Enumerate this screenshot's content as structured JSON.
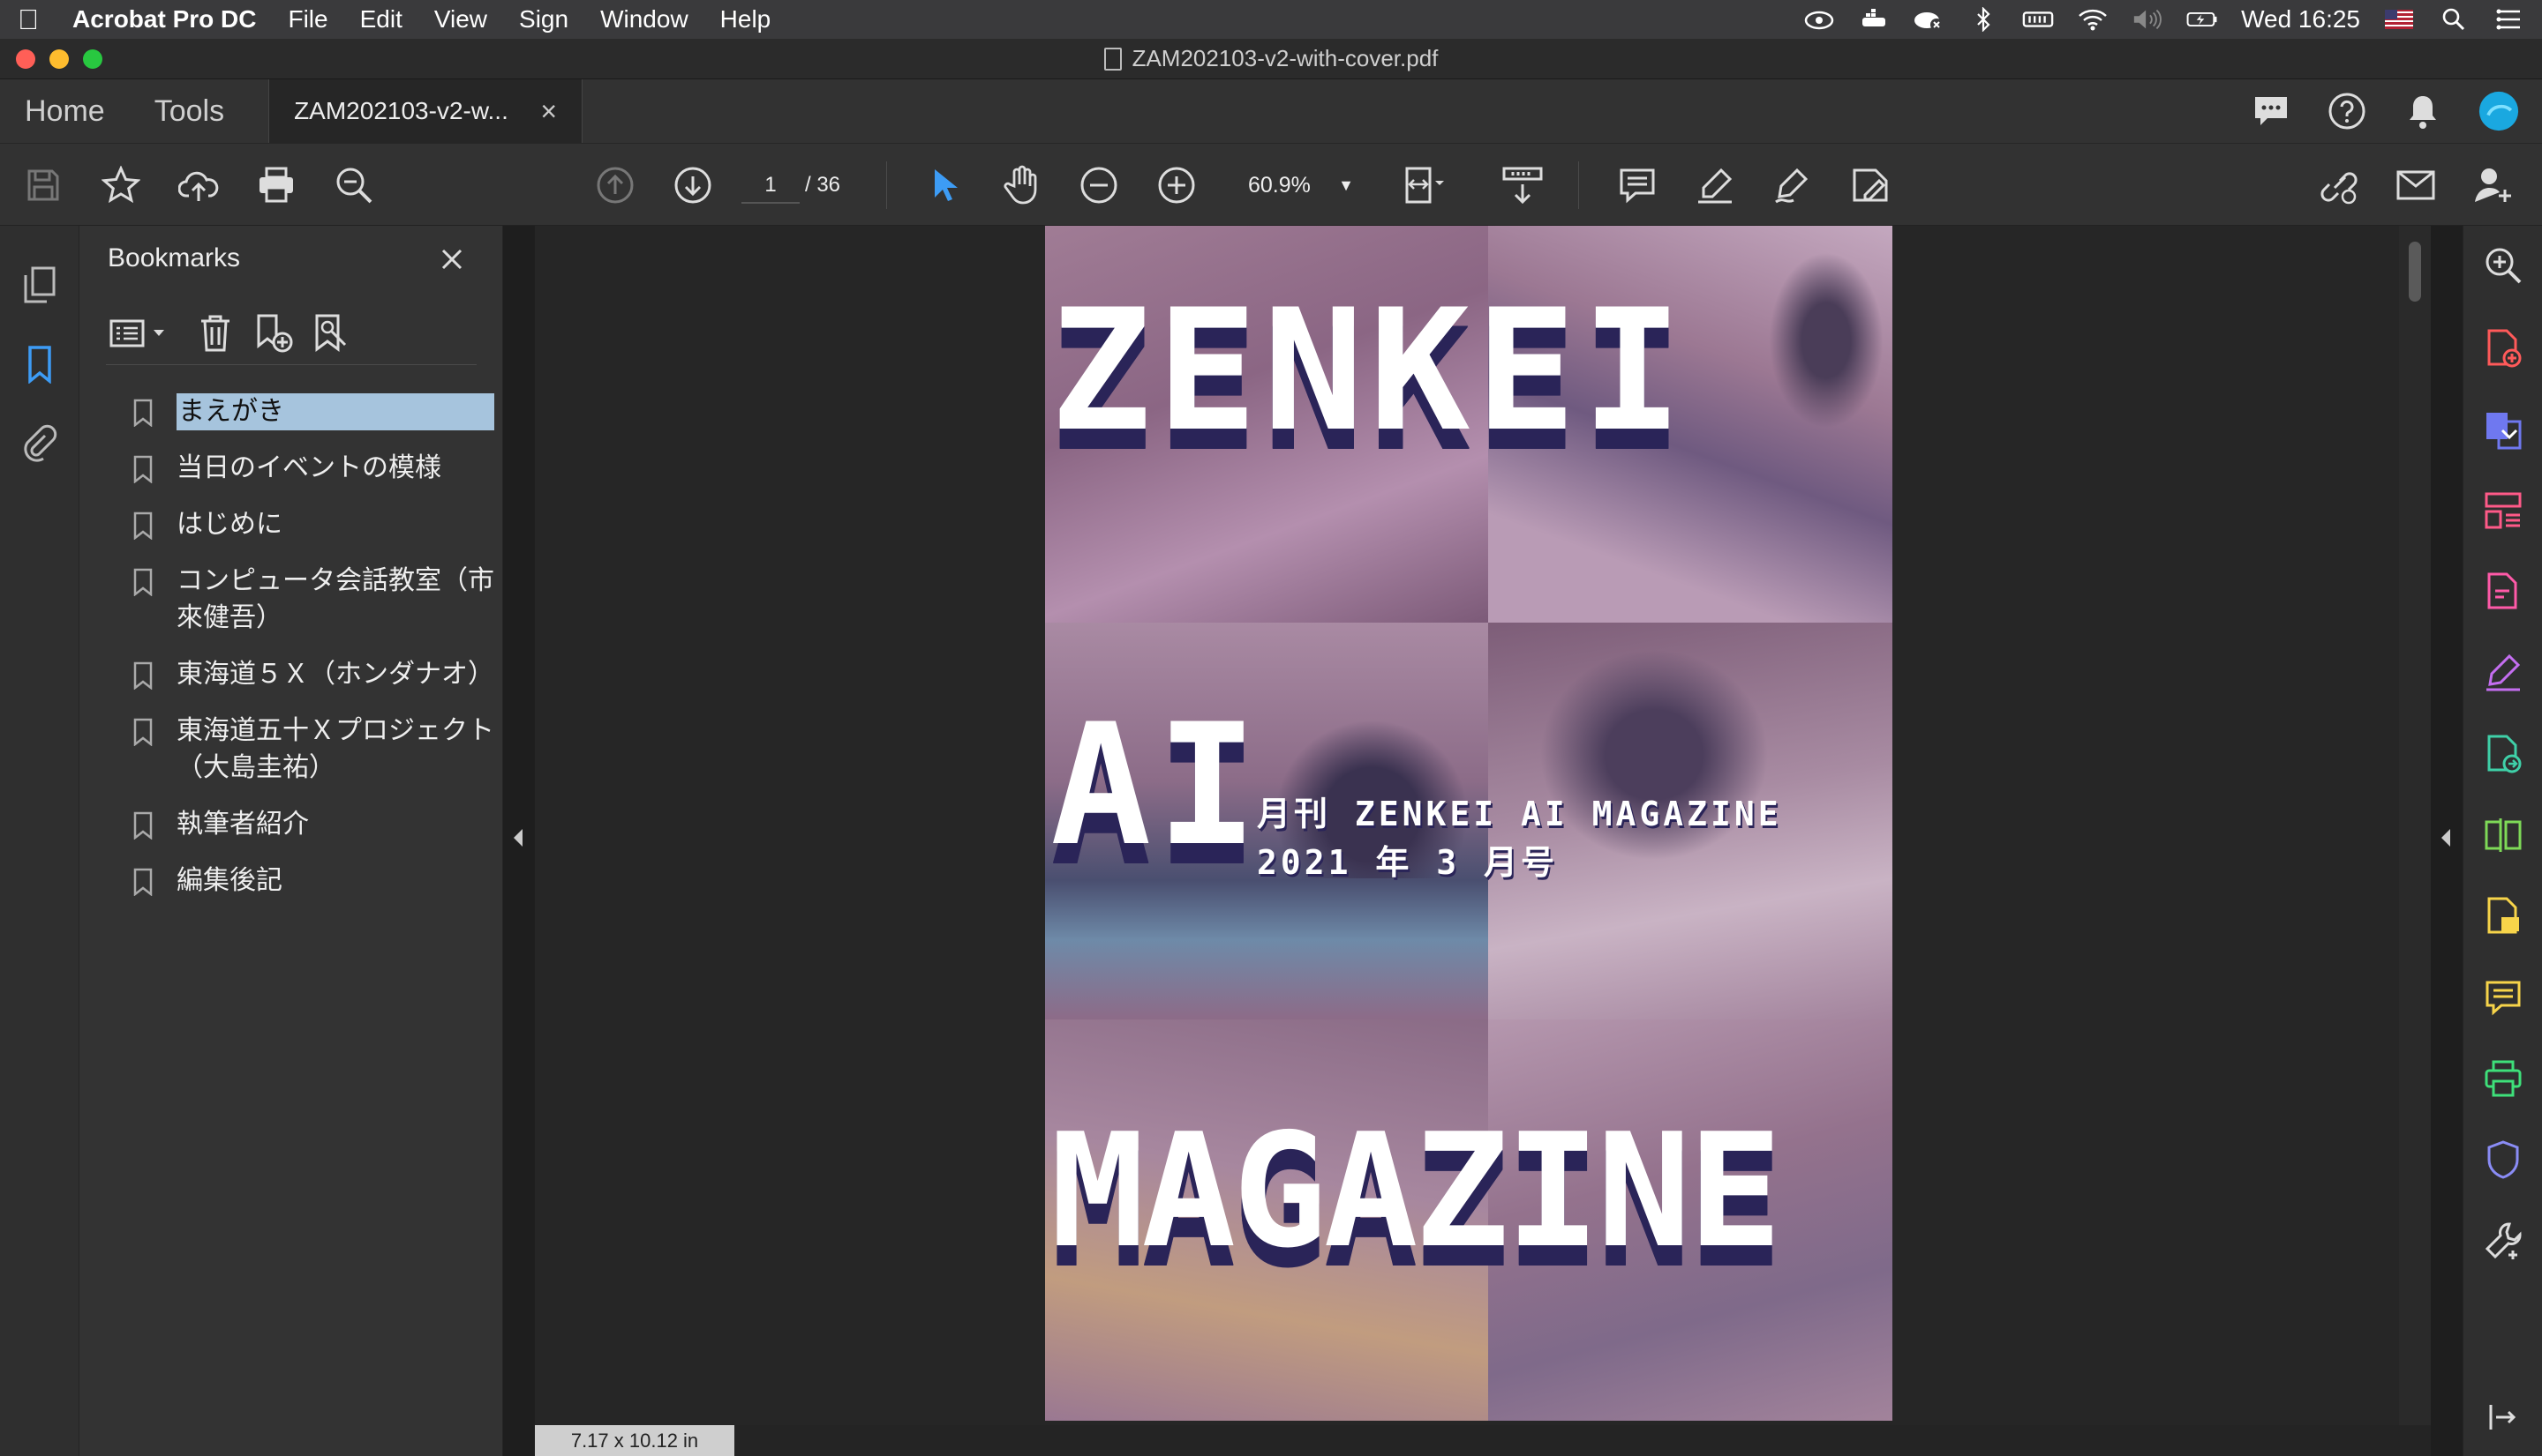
{
  "menubar": {
    "app_name": "Acrobat Pro DC",
    "menus": [
      "File",
      "Edit",
      "View",
      "Sign",
      "Window",
      "Help"
    ],
    "clock": "Wed 16:25"
  },
  "window": {
    "title": "ZAM202103-v2-with-cover.pdf"
  },
  "tabs": {
    "home": "Home",
    "tools": "Tools",
    "document_tab": "ZAM202103-v2-w...",
    "close_symbol": "×"
  },
  "toolbar": {
    "page_current": "1",
    "page_total": "/  36",
    "zoom": "60.9%"
  },
  "bookmarks": {
    "title": "Bookmarks",
    "items": [
      {
        "label": "まえがき",
        "selected": true
      },
      {
        "label": "当日のイベントの模様"
      },
      {
        "label": "はじめに"
      },
      {
        "label": "コンピュータ会話教室（市來健吾）"
      },
      {
        "label": "東海道５Ｘ（ホンダナオ）"
      },
      {
        "label": "東海道五十Ｘプロジェクト（大島圭祐）"
      },
      {
        "label": "執筆者紹介"
      },
      {
        "label": "編集後記"
      }
    ]
  },
  "document": {
    "page_size": "7.17 x 10.12 in",
    "cover": {
      "word1": "ZENKEI",
      "word2": "AI",
      "word3": "MAGAZINE",
      "subtitle": "月刊 ZENKEI AI MAGAZINE 2021 年 3 月号"
    }
  },
  "colors": {
    "selection": "#a6c4dd",
    "cover_tint": "#8c6a86",
    "cover_text_shadow": "#2a2458"
  }
}
